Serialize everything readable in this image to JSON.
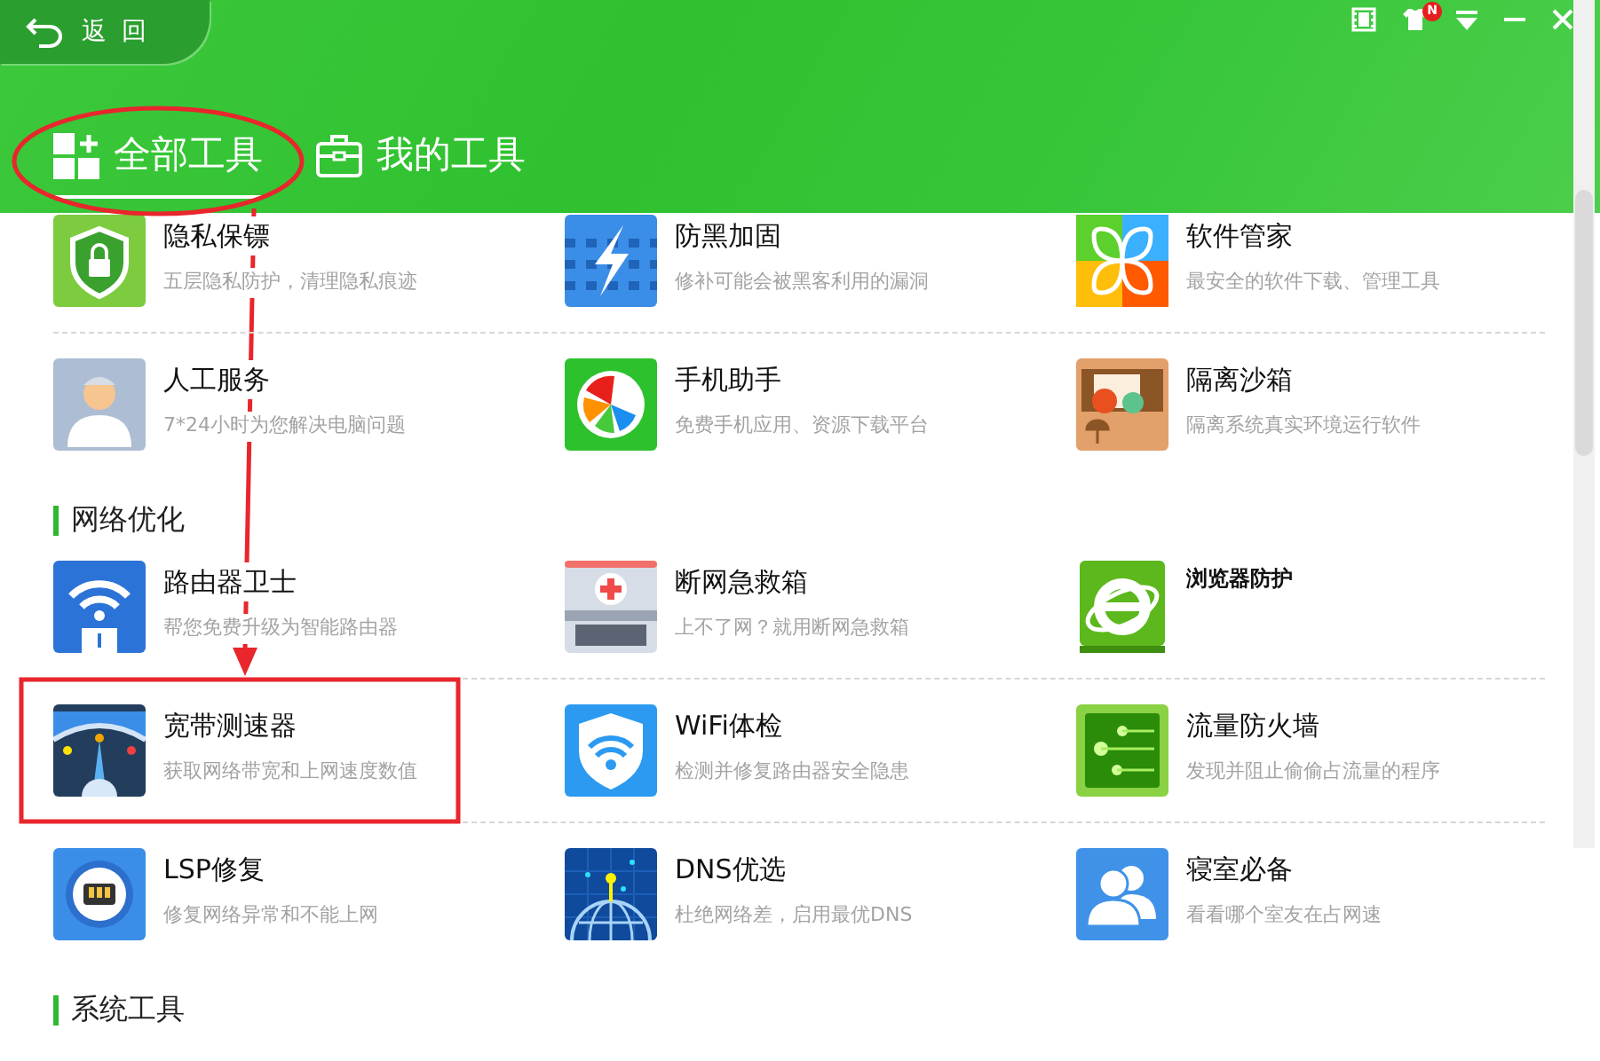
{
  "header": {
    "back_button": "返 回",
    "badge": "N",
    "tabs": [
      {
        "label": "全部工具",
        "selected": true,
        "circled": true
      },
      {
        "label": "我的工具",
        "selected": false,
        "circled": false
      }
    ]
  },
  "sections": [
    {
      "items": [
        {
          "title": "隐私保镖",
          "description": "五层隐私防护，清理隐私痕迹",
          "highlighted": false,
          "bold_title": false
        },
        {
          "title": "防黑加固",
          "description": "修补可能会被黑客利用的漏洞",
          "highlighted": false,
          "bold_title": false
        },
        {
          "title": "软件管家",
          "description": "最安全的软件下载、管理工具",
          "highlighted": false,
          "bold_title": false
        },
        {
          "title": "人工服务",
          "description": "7*24小时为您解决电脑问题",
          "highlighted": false,
          "bold_title": false
        },
        {
          "title": "手机助手",
          "description": "免费手机应用、资源下载平台",
          "highlighted": false,
          "bold_title": false
        },
        {
          "title": "隔离沙箱",
          "description": "隔离系统真实环境运行软件",
          "highlighted": false,
          "bold_title": false
        }
      ]
    },
    {
      "title": "网络优化",
      "items": [
        {
          "title": "路由器卫士",
          "description": "帮您免费升级为智能路由器",
          "highlighted": false,
          "bold_title": false
        },
        {
          "title": "断网急救箱",
          "description": "上不了网？就用断网急救箱",
          "highlighted": false,
          "bold_title": false
        },
        {
          "title": "浏览器防护",
          "highlighted": false,
          "bold_title": true
        },
        {
          "title": "宽带测速器",
          "description": "获取网络带宽和上网速度数值",
          "highlighted": true,
          "bold_title": false
        },
        {
          "title": "WiFi体检",
          "description": "检测并修复路由器安全隐患",
          "highlighted": false,
          "bold_title": false
        },
        {
          "title": "流量防火墙",
          "description": "发现并阻止偷偷占流量的程序",
          "highlighted": false,
          "bold_title": false
        },
        {
          "title": "LSP修复",
          "description": "修复网络异常和不能上网",
          "highlighted": false,
          "bold_title": false
        },
        {
          "title": "DNS优选",
          "description": "杜绝网络差，启用最优DNS",
          "highlighted": false,
          "bold_title": false
        },
        {
          "title": "寝室必备",
          "description": "看看哪个室友在占网速",
          "highlighted": false,
          "bold_title": false
        }
      ]
    },
    {
      "title": "系统工具"
    }
  ]
}
